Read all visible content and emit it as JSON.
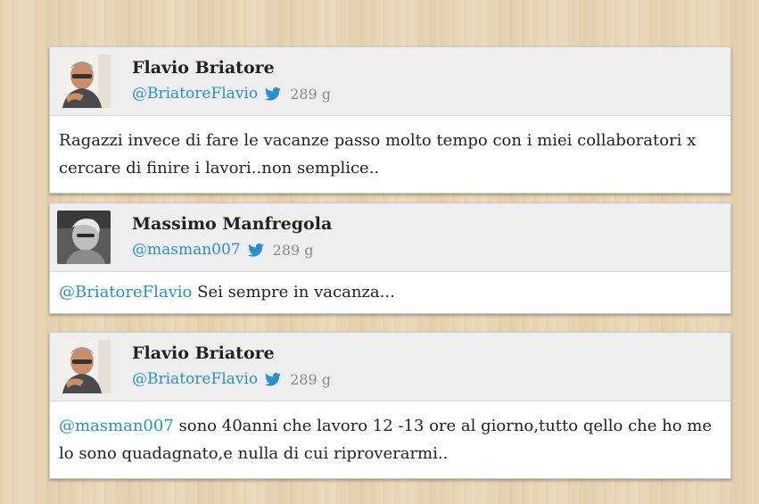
{
  "colors": {
    "mention": "#2a8fce",
    "header_bg": "#eeeeee",
    "card_bg": "#ffffff",
    "background": "#e9d5b4"
  },
  "tweets": [
    {
      "author": "Flavio Briatore",
      "handle": "@BriatoreFlavio",
      "time": "289 g",
      "icon": "twitter-bird-icon",
      "mention": "",
      "text": "Ragazzi invece di fare le vacanze passo molto tempo con i miei collaboratori x cercare di finire i lavori..non semplice.."
    },
    {
      "author": "Massimo Manfregola",
      "handle": "@masman007",
      "time": "289 g",
      "icon": "twitter-bird-icon",
      "mention": "@BriatoreFlavio",
      "text": " Sei sempre in vacanza..."
    },
    {
      "author": "Flavio Briatore",
      "handle": "@BriatoreFlavio",
      "time": "289 g",
      "icon": "twitter-bird-icon",
      "mention": "@masman007",
      "text": " sono 40anni che lavoro 12 -13 ore al giorno,tutto qello che ho me lo sono quadagnato,e nulla di cui riproverarmi.."
    }
  ]
}
